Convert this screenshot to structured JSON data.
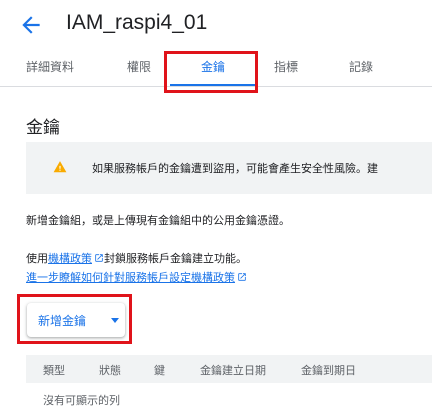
{
  "header": {
    "title": "IAM_raspi4_01",
    "back_icon": "arrow-back-icon"
  },
  "tabs": [
    {
      "label": "詳細資料",
      "active": false
    },
    {
      "label": "權限",
      "active": false
    },
    {
      "label": "金鑰",
      "active": true
    },
    {
      "label": "指標",
      "active": false
    },
    {
      "label": "記錄",
      "active": false
    }
  ],
  "main": {
    "section_title": "金鑰",
    "alert": {
      "icon": "warning-icon",
      "text": "如果服務帳戶的金鑰遭到盜用，可能會產生安全性風險。建"
    },
    "description": "新增金鑰組，或是上傳現有金鑰組中的公用金鑰憑證。",
    "policy_line": {
      "prefix": "使用",
      "link": "機構政策",
      "suffix": "封鎖服務帳戶金鑰建立功能。"
    },
    "learn_more_link": "進一步瞭解如何針對服務帳戶設定機構政策",
    "add_key_button": "新增金鑰",
    "table": {
      "columns": [
        "類型",
        "狀態",
        "鍵",
        "金鑰建立日期",
        "金鑰到期日"
      ],
      "empty_message": "沒有可顯示的列"
    }
  },
  "colors": {
    "accent": "#1a73e8",
    "highlight_box": "#e0131a",
    "warning": "#f9ab00",
    "alert_bg": "#f1f3f4"
  }
}
